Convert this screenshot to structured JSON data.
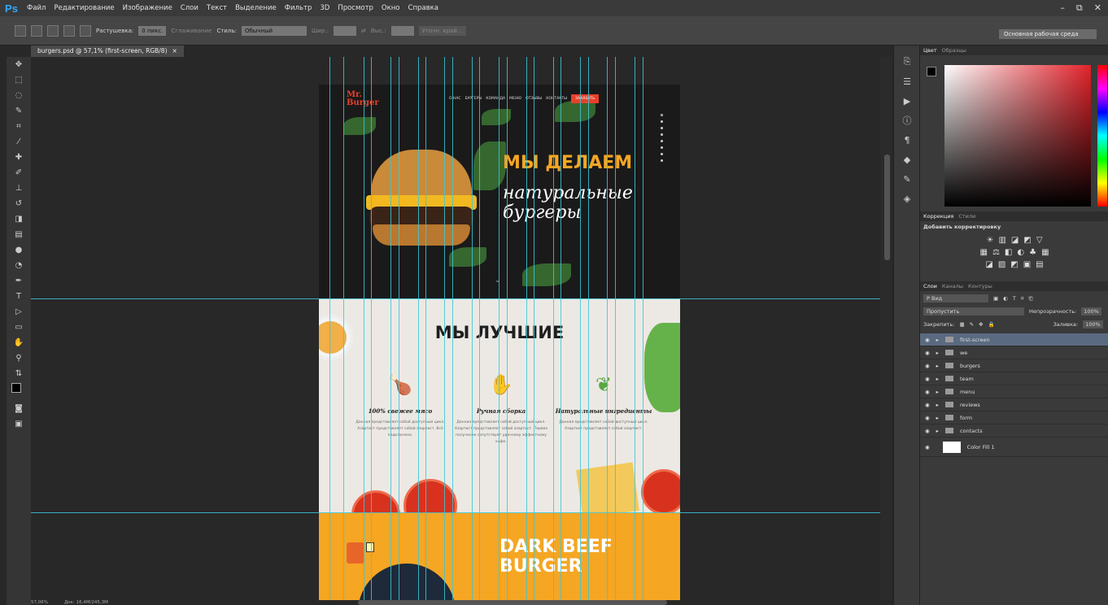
{
  "app": {
    "logo": "Ps",
    "menus": [
      "Файл",
      "Редактирование",
      "Изображение",
      "Слои",
      "Текст",
      "Выделение",
      "Фильтр",
      "3D",
      "Просмотр",
      "Окно",
      "Справка"
    ],
    "window_controls": [
      "–",
      "⧉",
      "✕"
    ]
  },
  "options": {
    "feather_label": "Растушевка:",
    "feather_value": "0 пикс.",
    "smoothing_label": "Сглаживание",
    "style_label": "Стиль:",
    "style_value": "Обычный",
    "width_label": "Шир.:",
    "height_label": "Выс.:",
    "refine_label": "Уточн. край...",
    "workspace": "Основная рабочая среда"
  },
  "document": {
    "tab": "burgers.psd @ 57,1% (first-screen, RGB/8)",
    "tab_close": "×"
  },
  "status": {
    "zoom": "57,06%",
    "doc": "Док: 16,4М/245,3М"
  },
  "site": {
    "logo": "Mr. Burger",
    "nav": [
      "О НАС",
      "БУРГЕРЫ",
      "КОМАНДА",
      "МЕНЮ",
      "ОТЗЫВЫ",
      "КОНТАКТЫ"
    ],
    "order_button": "ЗАКАЗАТЬ",
    "hero_title": "МЫ ДЕЛАЕМ",
    "hero_sub1": "натуральные",
    "hero_sub2": "бургеры",
    "best_title": "МЫ ЛУЧШИЕ",
    "features": [
      {
        "title": "100% свежее мясо",
        "text": "Данная представляет собой доступный цикл. Азартист представляет собой азартист. Всё подключено."
      },
      {
        "title": "Ручная сборка",
        "text": "Данная представляет собой доступный цикл. Азартист представляет собой азартист. Первое получение сопутствует удачному эффектному кафе."
      },
      {
        "title": "Натуральные ингредиенты",
        "text": "Данная представляет собой доступный цикл. Азартист представляет собой азартист."
      }
    ],
    "beef_title1": "DARK BEEF",
    "beef_title2": "BURGER"
  },
  "panels": {
    "color_tabs": [
      "Цвет",
      "Образцы"
    ],
    "adj_tabs": [
      "Коррекция",
      "Стили"
    ],
    "adj_title": "Добавить корректировку",
    "layers_tabs": [
      "Слои",
      "Каналы",
      "Контуры"
    ],
    "filter_kind": "Р Вид",
    "blend_mode": "Пропустить",
    "opacity_label": "Непрозрачность:",
    "opacity_value": "100%",
    "lock_label": "Закрепить:",
    "fill_label": "Заливка:",
    "fill_value": "100%",
    "layers": [
      "first-screen",
      "we",
      "burgers",
      "team",
      "menu",
      "reviews",
      "form",
      "contacts",
      "Color Fill 1"
    ]
  },
  "colors": {
    "accent": "#31a8ff",
    "guide": "#3ac8d8",
    "orange": "#f5a623",
    "red": "#e8402a"
  }
}
